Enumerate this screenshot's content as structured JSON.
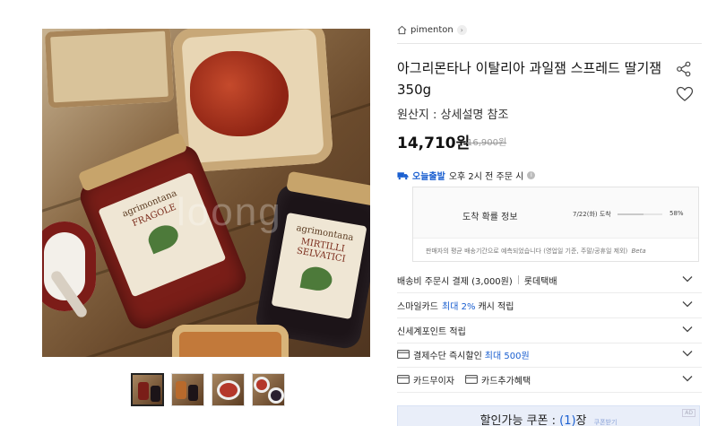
{
  "gallery": {
    "watermark": "loong",
    "jar_labels": [
      {
        "brand": "agrimontana",
        "flavor": "FRAGOLE"
      },
      {
        "brand": "agrimontana",
        "flavor": "MIRTILLI SELVATICI"
      }
    ],
    "thumbnails": [
      "thumb-1",
      "thumb-2",
      "thumb-3",
      "thumb-4"
    ],
    "active_index": 0
  },
  "store": {
    "name": "pimenton"
  },
  "product": {
    "title": "아그리몬타나 이탈리아 과일잼 스프레드 딸기잼 350g",
    "origin": "원산지 : 상세설명 참조",
    "price": "14,710원",
    "original_price": "16,900원"
  },
  "shipping": {
    "today_label": "오늘출발",
    "cutoff": "오후 2시 전 주문 시",
    "stats": {
      "title": "도착 확률 정보",
      "date": "7/22(화) 도착",
      "percent": "58%",
      "percent_value": 58,
      "note": "판매자의 평균 배송기간으로 예측되었습니다 (영업일 기준, 주말/공휴일 제외)",
      "note_brand": "Beta"
    }
  },
  "options": [
    {
      "text": "배송비 주문시 결제 (3,000원)",
      "extra": "롯데택배"
    },
    {
      "text": "스마일카드",
      "highlight": "최대 2%",
      "suffix": "캐시 적립"
    },
    {
      "text": "신세계포인트 적립"
    },
    {
      "text": "결제수단 즉시할인",
      "highlight": "최대 500원"
    },
    {
      "text": "카드무이자",
      "extra": "카드추가혜택"
    }
  ],
  "coupon": {
    "label": "할인가능 쿠폰 : ",
    "count": "(1)",
    "unit": "장",
    "download": "쿠폰받기",
    "corner": "AD"
  },
  "colors": {
    "accent": "#1a5fd0",
    "coupon_bg": "#e9eef9"
  }
}
